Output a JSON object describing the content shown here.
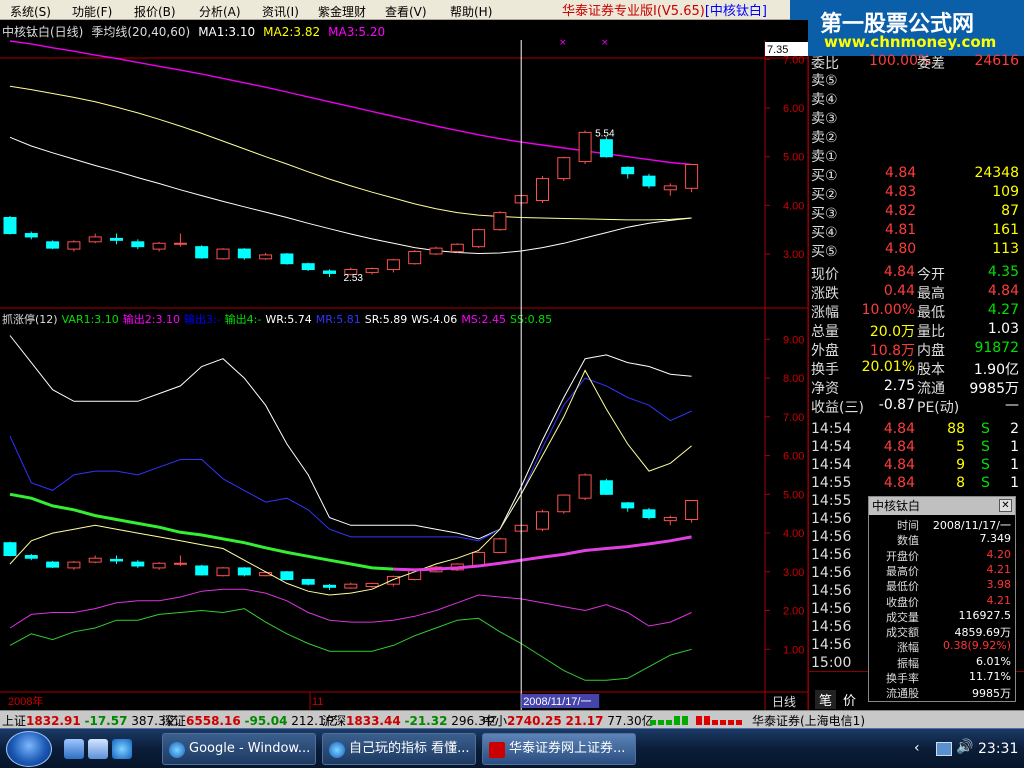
{
  "menu": {
    "items": [
      "系统(S)",
      "功能(F)",
      "报价(B)",
      "分析(A)",
      "资讯(I)",
      "紫金理财",
      "查看(V)",
      "帮助(H)"
    ],
    "app_title": "华泰证券专业版Ⅰ(V5.65)",
    "stock_tag": "[中核钛白]"
  },
  "banner": {
    "line1": "第一股票公式网",
    "line2": "www.chnmoney.com"
  },
  "price_chart": {
    "header": {
      "name": "中核钛白(日线)",
      "indicator": "季均线(20,40,60)",
      "ma1": "MA1:3.10",
      "ma2": "MA2:3.82",
      "ma3": "MA3:5.20"
    },
    "price_tag": "7.35",
    "y_ticks": [
      "7.00",
      "6.00",
      "5.00",
      "4.00",
      "3.00"
    ],
    "annotations": {
      "high": "5.54",
      "low": "2.53"
    }
  },
  "sub_chart": {
    "header": {
      "name": "抓涨停(12)",
      "var1": "VAR1:3.10",
      "out2": "输出2:3.10",
      "out3": "输出3:-",
      "out4": "输出4:-",
      "wr": "WR:5.74",
      "mr": "MR:5.81",
      "sr": "SR:5.89",
      "ws": "WS:4.06",
      "ms": "MS:2.45",
      "ss": "SS:0.85"
    },
    "y_ticks": [
      "9.00",
      "8.00",
      "7.00",
      "6.00",
      "5.00",
      "4.00",
      "3.00",
      "2.00",
      "1.00"
    ]
  },
  "time_axis": {
    "year": "2008年",
    "month": "11",
    "cursor_date": "2008/11/17/一",
    "period": "日线"
  },
  "quote_panel": {
    "top_label": "委比",
    "top_value": "100.00%",
    "top_label2": "委差",
    "top_value2": "24616",
    "asks": [
      {
        "label": "卖⑤"
      },
      {
        "label": "卖④"
      },
      {
        "label": "卖③"
      },
      {
        "label": "卖②"
      },
      {
        "label": "卖①"
      }
    ],
    "bids": [
      {
        "label": "买①",
        "price": "4.84",
        "vol": "24348"
      },
      {
        "label": "买②",
        "price": "4.83",
        "vol": "109"
      },
      {
        "label": "买③",
        "price": "4.82",
        "vol": "87"
      },
      {
        "label": "买④",
        "price": "4.81",
        "vol": "161"
      },
      {
        "label": "买⑤",
        "price": "4.80",
        "vol": "113"
      }
    ],
    "stats": [
      {
        "l1": "现价",
        "v1": "4.84",
        "l2": "今开",
        "v2": "4.35"
      },
      {
        "l1": "涨跌",
        "v1": "0.44",
        "l2": "最高",
        "v2": "4.84"
      },
      {
        "l1": "涨幅",
        "v1": "10.00%",
        "l2": "最低",
        "v2": "4.27"
      },
      {
        "l1": "总量",
        "v1": "20.0万",
        "l2": "量比",
        "v2": "1.03"
      },
      {
        "l1": "外盘",
        "v1": "10.8万",
        "l2": "内盘",
        "v2": "91872"
      },
      {
        "l1": "换手",
        "v1": "20.01%",
        "l2": "股本",
        "v2": "1.90亿"
      },
      {
        "l1": "净资",
        "v1": "2.75",
        "l2": "流通",
        "v2": "9985万"
      },
      {
        "l1": "收益(三)",
        "v1": "-0.87",
        "l2": "PE(动)",
        "v2": "—"
      }
    ],
    "ticks": [
      {
        "time": "14:54",
        "price": "4.84",
        "vol": "88",
        "side": "S",
        "n": "2"
      },
      {
        "time": "14:54",
        "price": "4.84",
        "vol": "5",
        "side": "S",
        "n": "1"
      },
      {
        "time": "14:54",
        "price": "4.84",
        "vol": "9",
        "side": "S",
        "n": "1"
      },
      {
        "time": "14:55",
        "price": "4.84",
        "vol": "8",
        "side": "S",
        "n": "1"
      },
      {
        "time": "14:55"
      },
      {
        "time": "14:56"
      },
      {
        "time": "14:56"
      },
      {
        "time": "14:56"
      },
      {
        "time": "14:56"
      },
      {
        "time": "14:56"
      },
      {
        "time": "14:56"
      },
      {
        "time": "14:56"
      },
      {
        "time": "14:56"
      },
      {
        "time": "15:00"
      }
    ],
    "tabs": [
      "笔",
      "价"
    ]
  },
  "popup": {
    "title": "中核钛白",
    "close": "✕",
    "rows": [
      {
        "k": "时间",
        "v": "2008/11/17/一"
      },
      {
        "k": "数值",
        "v": "7.349"
      },
      {
        "k": "开盘价",
        "v": "4.20"
      },
      {
        "k": "最高价",
        "v": "4.21"
      },
      {
        "k": "最低价",
        "v": "3.98"
      },
      {
        "k": "收盘价",
        "v": "4.21"
      },
      {
        "k": "成交量",
        "v": "116927.5"
      },
      {
        "k": "成交额",
        "v": "4859.69万"
      },
      {
        "k": "涨幅",
        "v": "0.38(9.92%)"
      },
      {
        "k": "振幅",
        "v": "6.01%"
      },
      {
        "k": "换手率",
        "v": "11.71%"
      },
      {
        "k": "流通股",
        "v": "9985万"
      }
    ]
  },
  "statusbar": {
    "sh_label": "上证",
    "sh_val": "1832.91",
    "sh_chg": "-17.57",
    "sh_amt": "387.3亿",
    "sz_label": "深证",
    "sz_val": "6558.16",
    "sz_chg": "-95.04",
    "sz_amt": "212.1亿",
    "hs_label": "沪深",
    "hs_val": "1833.44",
    "hs_chg": "-21.32",
    "hs_amt": "296.3亿",
    "zx_label": "中小",
    "zx_val": "2740.25",
    "zx_chg": "21.17",
    "zx_amt": "77.30亿",
    "broker": "华泰证券(上海电信1)"
  },
  "taskbar": {
    "items": [
      "Google - Window...",
      "自己玩的指标 看懂...",
      "华泰证券网上证券..."
    ],
    "clock": "23:31"
  },
  "chart_data": [
    {
      "type": "candlestick",
      "title": "中核钛白(日线) 季均线(20,40,60)",
      "ylim": [
        2.3,
        7.4
      ],
      "candles": [
        {
          "o": 3.75,
          "c": 3.42,
          "h": 3.78,
          "l": 3.4
        },
        {
          "o": 3.42,
          "c": 3.35,
          "h": 3.46,
          "l": 3.3
        },
        {
          "o": 3.25,
          "c": 3.12,
          "h": 3.28,
          "l": 3.1
        },
        {
          "o": 3.1,
          "c": 3.25,
          "h": 3.28,
          "l": 3.05
        },
        {
          "o": 3.25,
          "c": 3.35,
          "h": 3.42,
          "l": 3.22
        },
        {
          "o": 3.32,
          "c": 3.28,
          "h": 3.42,
          "l": 3.2
        },
        {
          "o": 3.25,
          "c": 3.15,
          "h": 3.3,
          "l": 3.1
        },
        {
          "o": 3.1,
          "c": 3.22,
          "h": 3.25,
          "l": 3.05
        },
        {
          "o": 3.2,
          "c": 3.22,
          "h": 3.42,
          "l": 3.15
        },
        {
          "o": 3.15,
          "c": 2.92,
          "h": 3.18,
          "l": 2.9
        },
        {
          "o": 2.9,
          "c": 3.1,
          "h": 3.12,
          "l": 2.88
        },
        {
          "o": 3.1,
          "c": 2.92,
          "h": 3.12,
          "l": 2.88
        },
        {
          "o": 2.9,
          "c": 2.98,
          "h": 3.02,
          "l": 2.88
        },
        {
          "o": 3.0,
          "c": 2.8,
          "h": 3.02,
          "l": 2.78
        },
        {
          "o": 2.8,
          "c": 2.68,
          "h": 2.82,
          "l": 2.65
        },
        {
          "o": 2.65,
          "c": 2.6,
          "h": 2.68,
          "l": 2.53
        },
        {
          "o": 2.58,
          "c": 2.68,
          "h": 2.72,
          "l": 2.56
        },
        {
          "o": 2.62,
          "c": 2.7,
          "h": 2.72,
          "l": 2.58
        },
        {
          "o": 2.68,
          "c": 2.88,
          "h": 2.9,
          "l": 2.62
        },
        {
          "o": 2.8,
          "c": 3.05,
          "h": 3.08,
          "l": 2.78
        },
        {
          "o": 3.0,
          "c": 3.12,
          "h": 3.15,
          "l": 2.98
        },
        {
          "o": 3.05,
          "c": 3.2,
          "h": 3.22,
          "l": 3.02
        },
        {
          "o": 3.15,
          "c": 3.5,
          "h": 3.52,
          "l": 3.12
        },
        {
          "o": 3.5,
          "c": 3.85,
          "h": 3.88,
          "l": 3.48
        },
        {
          "o": 4.05,
          "c": 4.2,
          "h": 4.21,
          "l": 3.98
        },
        {
          "o": 4.1,
          "c": 4.55,
          "h": 4.6,
          "l": 4.05
        },
        {
          "o": 4.55,
          "c": 4.98,
          "h": 5.0,
          "l": 4.5
        },
        {
          "o": 4.9,
          "c": 5.5,
          "h": 5.54,
          "l": 4.85
        },
        {
          "o": 5.35,
          "c": 5.0,
          "h": 5.4,
          "l": 4.98
        },
        {
          "o": 4.78,
          "c": 4.65,
          "h": 4.8,
          "l": 4.55
        },
        {
          "o": 4.6,
          "c": 4.4,
          "h": 4.65,
          "l": 4.35
        },
        {
          "o": 4.32,
          "c": 4.4,
          "h": 4.45,
          "l": 4.2
        },
        {
          "o": 4.35,
          "c": 4.84,
          "h": 4.84,
          "l": 4.27
        }
      ],
      "series": [
        {
          "name": "MA1",
          "values": [
            5.4,
            5.22,
            5.08,
            4.95,
            4.82,
            4.7,
            4.57,
            4.45,
            4.32,
            4.2,
            4.08,
            3.97,
            3.86,
            3.75,
            3.63,
            3.52,
            3.41,
            3.31,
            3.22,
            3.13,
            3.07,
            3.03,
            3.01,
            3.02,
            3.06,
            3.13,
            3.22,
            3.33,
            3.44,
            3.55,
            3.63,
            3.69,
            3.74
          ]
        },
        {
          "name": "MA2",
          "values": [
            6.45,
            6.38,
            6.3,
            6.22,
            6.13,
            6.02,
            5.9,
            5.77,
            5.63,
            5.48,
            5.32,
            5.16,
            5.0,
            4.85,
            4.69,
            4.54,
            4.4,
            4.27,
            4.15,
            4.03,
            3.93,
            3.85,
            3.8,
            3.77,
            3.75,
            3.74,
            3.73,
            3.72,
            3.71,
            3.7,
            3.7,
            3.71,
            3.74
          ]
        },
        {
          "name": "MA3",
          "values": [
            7.38,
            7.32,
            7.24,
            7.17,
            7.09,
            7.02,
            6.94,
            6.86,
            6.78,
            6.7,
            6.61,
            6.52,
            6.43,
            6.33,
            6.23,
            6.13,
            6.03,
            5.93,
            5.83,
            5.73,
            5.63,
            5.54,
            5.45,
            5.37,
            5.3,
            5.24,
            5.18,
            5.12,
            5.06,
            5.0,
            4.94,
            4.88,
            4.84
          ]
        }
      ]
    },
    {
      "type": "line",
      "title": "抓涨停(12)",
      "ylim": [
        0,
        9.5
      ],
      "series": [
        {
          "name": "WR",
          "values": [
            9.1,
            8.4,
            7.7,
            7.4,
            7.4,
            7.4,
            7.4,
            7.6,
            7.8,
            8.3,
            8.5,
            8.0,
            7.3,
            6.3,
            5.5,
            4.4,
            4.2,
            4.2,
            4.2,
            4.2,
            4.1,
            4.0,
            3.85,
            4.1,
            5.2,
            6.4,
            7.5,
            8.5,
            8.6,
            8.4,
            8.3,
            8.1,
            8.05
          ]
        },
        {
          "name": "MR",
          "values": [
            6.5,
            5.3,
            5.1,
            5.5,
            5.6,
            5.6,
            5.5,
            5.7,
            5.9,
            5.9,
            5.4,
            5.1,
            4.8,
            4.9,
            4.6,
            4.1,
            3.9,
            3.9,
            3.9,
            3.9,
            3.9,
            3.9,
            3.8,
            4.1,
            5.0,
            6.2,
            7.3,
            8.0,
            7.8,
            7.5,
            7.3,
            6.9,
            7.15
          ]
        },
        {
          "name": "SR",
          "values": [
            3.2,
            3.8,
            4.0,
            4.1,
            4.2,
            4.1,
            4.0,
            3.9,
            3.8,
            3.7,
            3.6,
            3.3,
            3.0,
            2.7,
            2.5,
            2.4,
            2.45,
            2.55,
            2.8,
            3.0,
            3.2,
            3.35,
            3.55,
            4.1,
            5.0,
            6.0,
            7.0,
            8.2,
            7.2,
            6.3,
            5.6,
            5.8,
            6.25
          ]
        },
        {
          "name": "WS",
          "values": [
            5.0,
            4.9,
            4.7,
            4.6,
            4.45,
            4.35,
            4.25,
            4.15,
            4.02,
            3.95,
            3.85,
            3.75,
            3.62,
            3.5,
            3.4,
            3.3,
            3.2,
            3.1,
            3.07,
            3.05,
            3.07,
            3.1,
            3.15,
            3.22,
            3.3,
            3.38,
            3.45,
            3.55,
            3.6,
            3.65,
            3.72,
            3.8,
            3.9
          ]
        },
        {
          "name": "MS",
          "values": [
            1.55,
            1.9,
            1.95,
            1.95,
            2.05,
            2.2,
            2.25,
            2.25,
            2.35,
            2.5,
            2.55,
            2.55,
            2.45,
            2.25,
            1.95,
            1.75,
            1.7,
            1.7,
            1.75,
            1.85,
            2.0,
            2.2,
            2.4,
            2.35,
            2.3,
            2.2,
            2.1,
            2.0,
            2.15,
            1.95,
            1.6,
            1.7,
            1.95
          ]
        },
        {
          "name": "SS",
          "values": [
            1.1,
            1.4,
            1.25,
            1.45,
            1.55,
            1.75,
            1.75,
            1.9,
            1.95,
            2.0,
            1.95,
            2.05,
            1.7,
            1.4,
            1.15,
            0.95,
            0.95,
            0.95,
            1.1,
            1.35,
            1.55,
            1.75,
            1.8,
            1.45,
            1.15,
            0.8,
            0.45,
            0.2,
            0.2,
            0.25,
            0.55,
            0.85,
            1.0
          ]
        }
      ]
    }
  ]
}
